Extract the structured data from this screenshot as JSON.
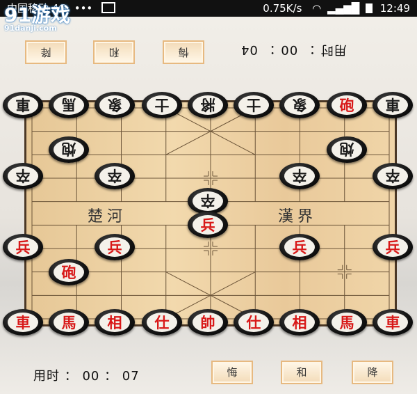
{
  "status_bar": {
    "carrier": "中国移动 4G",
    "indicators": "•••",
    "speed": "0.75K/s",
    "time": "12:49"
  },
  "watermark": {
    "logo": "91游戏",
    "url": "91danji.com"
  },
  "top_player": {
    "buttons": [
      "降",
      "和",
      "悔"
    ],
    "timer": "用时 ： 00 ： 04"
  },
  "bottom_player": {
    "buttons": [
      "悔",
      "和",
      "降"
    ],
    "timer": "用时 ： 00 ： 07"
  },
  "board": {
    "river_left": "楚河",
    "river_right": "漢界",
    "pieces": [
      {
        "id": "t1",
        "label": "車",
        "side": "black",
        "flip": true
      },
      {
        "id": "t2",
        "label": "馬",
        "side": "black",
        "flip": true
      },
      {
        "id": "t3",
        "label": "象",
        "side": "black",
        "flip": true
      },
      {
        "id": "t4",
        "label": "士",
        "side": "black",
        "flip": true
      },
      {
        "id": "t5",
        "label": "將",
        "side": "black",
        "flip": true
      },
      {
        "id": "t6",
        "label": "士",
        "side": "black",
        "flip": true
      },
      {
        "id": "t7",
        "label": "象",
        "side": "black",
        "flip": true
      },
      {
        "id": "t8",
        "label": "砲",
        "side": "red",
        "flip": false
      },
      {
        "id": "t9",
        "label": "車",
        "side": "black",
        "flip": true
      },
      {
        "id": "c1",
        "label": "炮",
        "side": "black",
        "flip": true
      },
      {
        "id": "c2",
        "label": "炮",
        "side": "black",
        "flip": true
      },
      {
        "id": "z1",
        "label": "卒",
        "side": "black",
        "flip": true
      },
      {
        "id": "z2",
        "label": "卒",
        "side": "black",
        "flip": true
      },
      {
        "id": "z3",
        "label": "卒",
        "side": "black",
        "flip": true
      },
      {
        "id": "z4",
        "label": "卒",
        "side": "black",
        "flip": true
      },
      {
        "id": "z5",
        "label": "卒",
        "side": "black",
        "flip": true
      },
      {
        "id": "b1",
        "label": "兵",
        "side": "red",
        "flip": false
      },
      {
        "id": "b2",
        "label": "兵",
        "side": "red",
        "flip": false
      },
      {
        "id": "b3",
        "label": "兵",
        "side": "red",
        "flip": false
      },
      {
        "id": "b4",
        "label": "兵",
        "side": "red",
        "flip": false
      },
      {
        "id": "b5",
        "label": "兵",
        "side": "red",
        "flip": false
      },
      {
        "id": "p1",
        "label": "砲",
        "side": "red",
        "flip": false
      },
      {
        "id": "r1",
        "label": "車",
        "side": "red",
        "flip": false
      },
      {
        "id": "r2",
        "label": "馬",
        "side": "red",
        "flip": false
      },
      {
        "id": "r3",
        "label": "相",
        "side": "red",
        "flip": false
      },
      {
        "id": "r4",
        "label": "仕",
        "side": "red",
        "flip": false
      },
      {
        "id": "r5",
        "label": "帥",
        "side": "red",
        "flip": false
      },
      {
        "id": "r6",
        "label": "仕",
        "side": "red",
        "flip": false
      },
      {
        "id": "r7",
        "label": "相",
        "side": "red",
        "flip": false
      },
      {
        "id": "r8",
        "label": "馬",
        "side": "red",
        "flip": false
      },
      {
        "id": "r9",
        "label": "車",
        "side": "red",
        "flip": false
      }
    ]
  }
}
